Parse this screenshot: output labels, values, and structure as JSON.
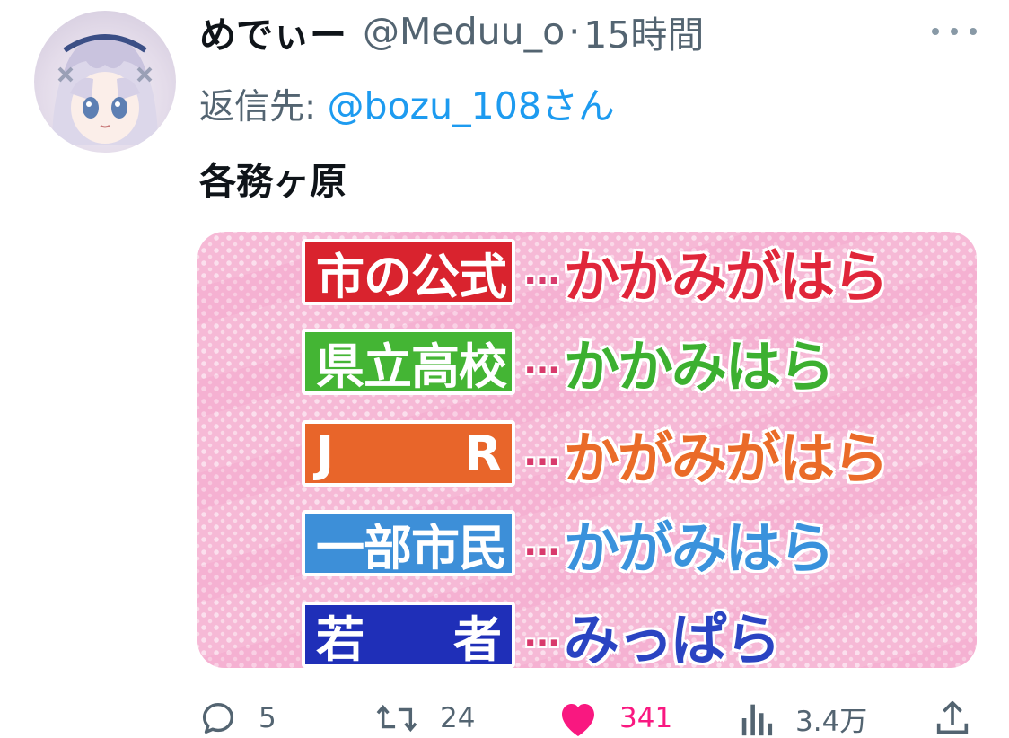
{
  "author": {
    "display_name": "めでぃー",
    "handle": "@Meduu_o",
    "separator": "·",
    "time": "15時間"
  },
  "reply_to": {
    "prefix": "返信先: ",
    "handle": "@bozu_108さん"
  },
  "text": "各務ヶ原",
  "media": {
    "rows": [
      {
        "tag": "市の公式",
        "tag_color": "#d9232e",
        "dots": "…",
        "reading": "かかみがはら",
        "reading_color": "#e0263a"
      },
      {
        "tag": "県立高校",
        "tag_color": "#44b534",
        "dots": "…",
        "reading": "かかみはら",
        "reading_color": "#3cb030"
      },
      {
        "tag_left": "J",
        "tag_right": "R",
        "tag_color": "#e8652a",
        "dots": "…",
        "reading": "かがみがはら",
        "reading_color": "#ea6b28"
      },
      {
        "tag": "一部市民",
        "tag_color": "#3d8fd8",
        "dots": "…",
        "reading": "かがみはら",
        "reading_color": "#3a92dc"
      },
      {
        "tag_left": "若",
        "tag_right": "者",
        "tag_color": "#1f2fb8",
        "dots": "…",
        "reading": "みっぱら",
        "reading_color": "#2a44c2"
      }
    ]
  },
  "actions": {
    "reply_count": "5",
    "retweet_count": "24",
    "like_count": "341",
    "views_count": "3.4万",
    "like_color": "#f91880"
  }
}
